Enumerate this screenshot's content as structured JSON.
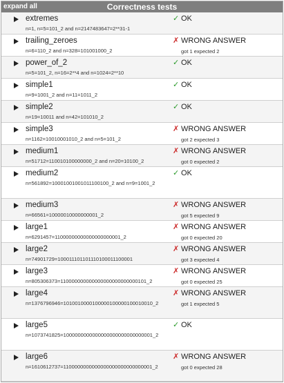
{
  "header": {
    "expand_label": "expand all",
    "title": "Correctness tests"
  },
  "colors": {
    "header_bg": "#7f7f7f",
    "ok": "#2a9a2a",
    "wrong": "#cc2a2a"
  },
  "tests": [
    {
      "name": "extremes",
      "detail": "n=1, n=5=101_2 and n=2147483647=2**31-1",
      "status": "OK",
      "ok": true,
      "got": ""
    },
    {
      "name": "trailing_zeroes",
      "detail": "n=6=110_2 and n=328=101001000_2",
      "status": "WRONG ANSWER",
      "ok": false,
      "got": "got 1 expected 2"
    },
    {
      "name": "power_of_2",
      "detail": "n=5=101_2, n=16=2**4 and n=1024=2**10",
      "status": "OK",
      "ok": true,
      "got": ""
    },
    {
      "name": "simple1",
      "detail": "n=9=1001_2 and n=11=1011_2",
      "status": "OK",
      "ok": true,
      "got": ""
    },
    {
      "name": "simple2",
      "detail": "n=19=10011 and n=42=101010_2",
      "status": "OK",
      "ok": true,
      "got": ""
    },
    {
      "name": "simple3",
      "detail": "n=1162=10010001010_2 and n=5=101_2",
      "status": "WRONG ANSWER",
      "ok": false,
      "got": "got 2 expected 3"
    },
    {
      "name": "medium1",
      "detail": "n=51712=110010100000000_2 and n=20=10100_2",
      "status": "WRONG ANSWER",
      "ok": false,
      "got": "got 0 expected 2"
    },
    {
      "name": "medium2",
      "detail": "n=561892=10001001001011100100_2 and n=9=1001_2",
      "status": "OK",
      "ok": true,
      "got": ""
    },
    {
      "name": "medium3",
      "detail": "n=66561=10000010000000001_2",
      "status": "WRONG ANSWER",
      "ok": false,
      "got": "got 5 expected 9"
    },
    {
      "name": "large1",
      "detail": "n=6291457=11000000000000000000001_2",
      "status": "WRONG ANSWER",
      "ok": false,
      "got": "got 0 expected 20"
    },
    {
      "name": "large2",
      "detail": "n=74901729=100011101101110100011100001",
      "status": "WRONG ANSWER",
      "ok": false,
      "got": "got 3 expected 4"
    },
    {
      "name": "large3",
      "detail": "n=805306373=110000000000000000000000000101_2",
      "status": "WRONG ANSWER",
      "ok": false,
      "got": "got 0 expected 25"
    },
    {
      "name": "large4",
      "detail": "n=1376796946=1010010000100000100000100010010_2",
      "status": "WRONG ANSWER",
      "ok": false,
      "got": "got 1 expected 5"
    },
    {
      "name": "large5",
      "detail": "n=1073741825=1000000000000000000000000000001_2",
      "status": "OK",
      "ok": true,
      "got": ""
    },
    {
      "name": "large6",
      "detail": "n=1610612737=1100000000000000000000000000001_2",
      "status": "WRONG ANSWER",
      "ok": false,
      "got": "got 0 expected 28"
    }
  ]
}
